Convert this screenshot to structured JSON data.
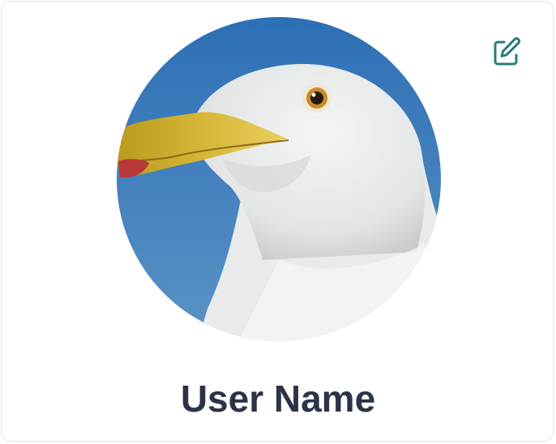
{
  "profile": {
    "name": "User Name",
    "edit_icon": "edit-icon",
    "avatar_subject": "seagull"
  },
  "colors": {
    "name_text": "#2b3447",
    "edit_icon": "#2a7a78",
    "card_border": "#e3e6ec",
    "sky": "#3f7fbf"
  }
}
